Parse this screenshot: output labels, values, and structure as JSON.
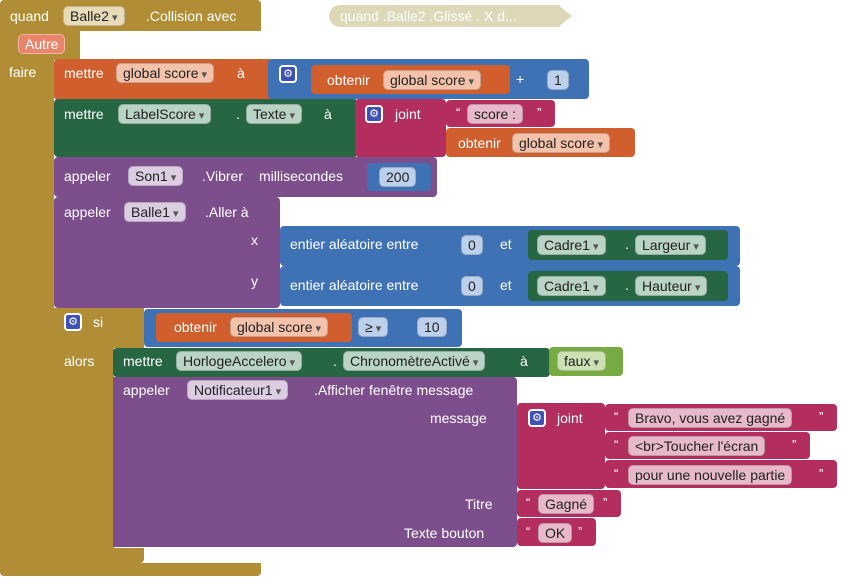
{
  "event": {
    "when": "quand",
    "component": "Balle2",
    "event_name": ".Collision avec",
    "param": "Autre",
    "do": "faire"
  },
  "collapsed_event": {
    "text": "quand .Balle2 .Glissé . X d..."
  },
  "set_score": {
    "set": "mettre",
    "var": "global score",
    "to": "à",
    "get": "obtenir",
    "get_var": "global score",
    "op": "+",
    "num": "1"
  },
  "set_label": {
    "set": "mettre",
    "component": "LabelScore",
    "dot": ".",
    "prop": "Texte",
    "to": "à",
    "join": "joint",
    "str_open": "“",
    "str_close": "”",
    "text": "score :",
    "get": "obtenir",
    "get_var": "global score"
  },
  "vibrate": {
    "call": "appeler",
    "component": "Son1",
    "method": ".Vibrer",
    "param": "millisecondes",
    "value": "200"
  },
  "moveto": {
    "call": "appeler",
    "component": "Balle1",
    "method": ".Aller à",
    "x_label": "x",
    "y_label": "y",
    "random_label": "entier aléatoire entre",
    "and_label": "et",
    "x_from": "0",
    "y_from": "0",
    "canvas": "Cadre1",
    "dot": ".",
    "width_prop": "Largeur",
    "height_prop": "Hauteur"
  },
  "if_block": {
    "if": "si",
    "then": "alors",
    "get": "obtenir",
    "get_var": "global score",
    "op": "≥",
    "value": "10"
  },
  "set_timer": {
    "set": "mettre",
    "component": "HorlogeAccelero",
    "dot": ".",
    "prop": "ChronomètreActivé",
    "to": "à",
    "value": "faux"
  },
  "notifier": {
    "call": "appeler",
    "component": "Notificateur1",
    "method": ".Afficher fenêtre message",
    "message_label": "message",
    "join": "joint",
    "str1": "Bravo, vous avez gagné",
    "str2": "<br>Toucher l'écran",
    "str3": "pour une nouvelle partie",
    "title_label": "Titre",
    "title": "Gagné",
    "button_label": "Texte bouton",
    "button": "OK",
    "str_open": "“",
    "str_close": "”"
  },
  "colors": {
    "event": "#b18e35",
    "variables": "#d05f2d",
    "math": "#3f71b5",
    "component_set": "#266643",
    "component_call": "#7d4e8c",
    "text": "#b32d5e",
    "logic": "#77ab41",
    "control": "#b18e35"
  }
}
